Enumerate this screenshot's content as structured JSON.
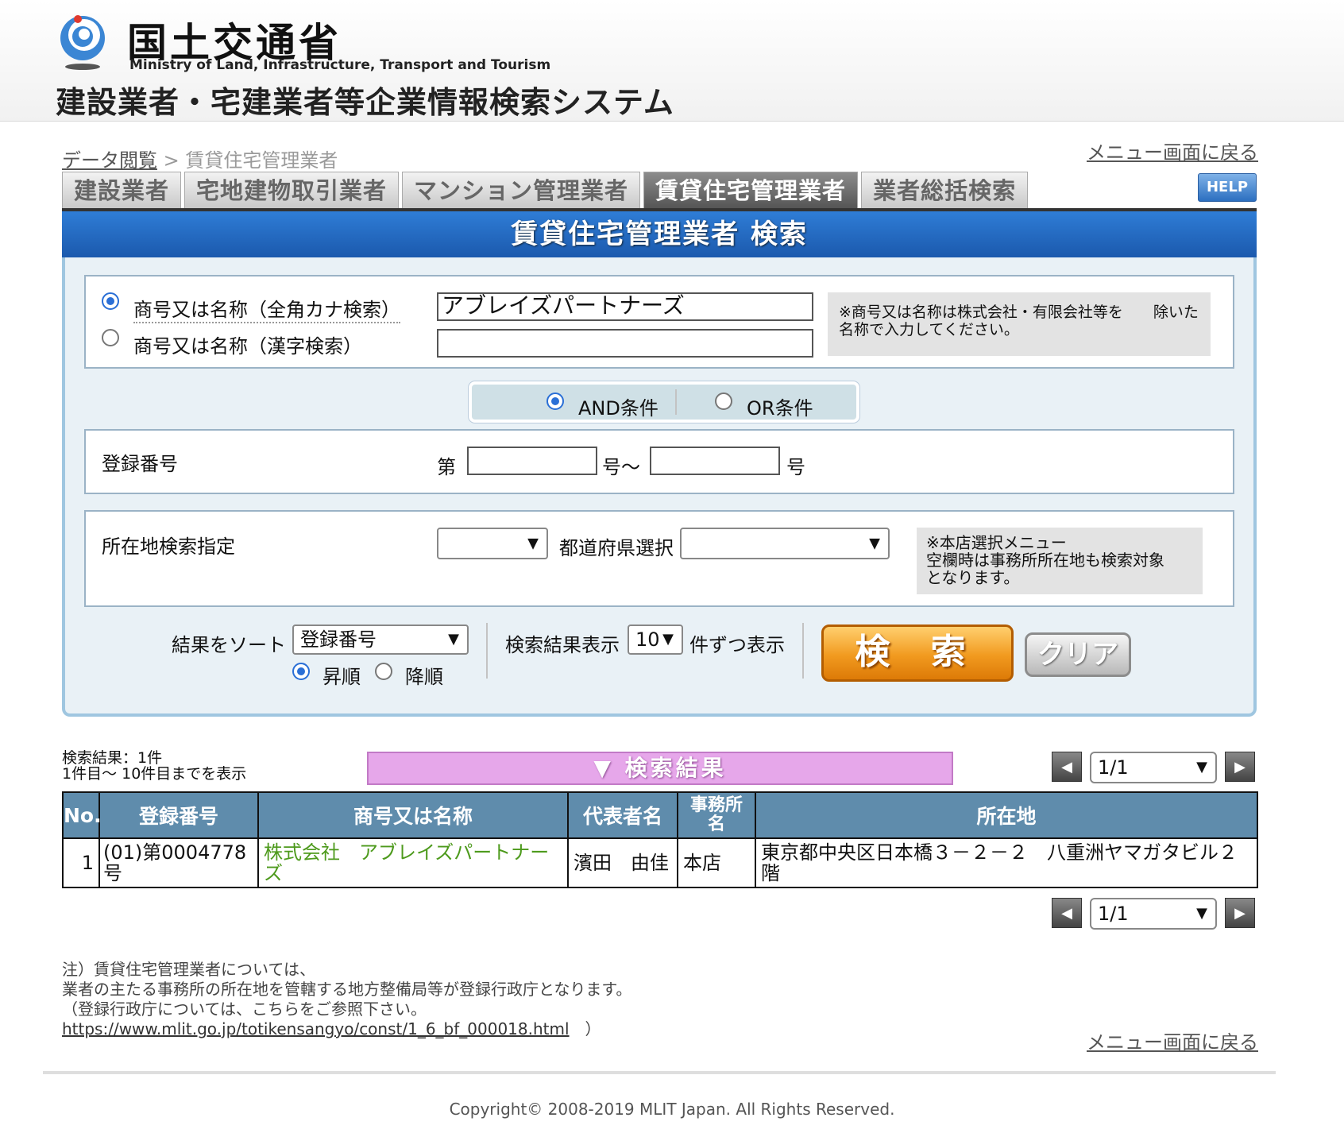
{
  "header": {
    "ministry_jp": "国土交通省",
    "ministry_en": "Ministry of Land, Infrastructure, Transport and Tourism",
    "system_title": "建設業者・宅建業者等企業情報検索システム"
  },
  "breadcrumb": {
    "root": "データ閲覧",
    "separator": " > ",
    "current": "賃貸住宅管理業者"
  },
  "back_to_menu": "メニュー画面に戻る",
  "tabs": [
    {
      "label": "建設業者"
    },
    {
      "label": "宅地建物取引業者"
    },
    {
      "label": "マンション管理業者"
    },
    {
      "label": "賃貸住宅管理業者",
      "active": true
    },
    {
      "label": "業者総括検索"
    }
  ],
  "help_label": "HELP",
  "panel_title": "賃貸住宅管理業者 検索",
  "name_search": {
    "option_kana": "商号又は名称（全角カナ検索）",
    "option_kanji": "商号又は名称（漢字検索）",
    "kana_value": "アブレイズパートナーズ",
    "kanji_value": "",
    "note": "※商号又は名称は株式会社・有限会社等を　　除いた名称で入力してください。"
  },
  "condition": {
    "and_label": "AND条件",
    "or_label": "OR条件",
    "selected": "AND"
  },
  "registration": {
    "label": "登録番号",
    "prefix": "第",
    "mid": "号〜",
    "suffix": "号",
    "from_value": "",
    "to_value": ""
  },
  "location": {
    "label": "所在地検索指定",
    "location_value": "",
    "pref_label": "都道府県選択",
    "pref_value": "",
    "note_line1": "※本店選択メニュー",
    "note_line2": "空欄時は事務所所在地も検索対象",
    "note_line3": "となります。"
  },
  "sort": {
    "label": "結果をソート",
    "value": "登録番号",
    "asc_label": "昇順",
    "desc_label": "降順",
    "selected": "asc"
  },
  "display": {
    "label": "検索結果表示",
    "value": "10",
    "suffix": "件ずつ表示"
  },
  "buttons": {
    "search": "検 索",
    "clear": "クリア"
  },
  "results": {
    "count_line1": "検索結果：1件",
    "count_line2": "1件目〜 10件目までを表示",
    "banner": "▼ 検索結果",
    "page_value": "1/1",
    "columns": [
      "No.",
      "登録番号",
      "商号又は名称",
      "代表者名",
      "事務所名",
      "所在地"
    ],
    "rows": [
      {
        "no": "1",
        "reg": "(01)第0004778号",
        "name": "株式会社　アブレイズパートナーズ",
        "rep": "濱田　由佳",
        "office": "本店",
        "address": "東京都中央区日本橋３－２－２　八重洲ヤマガタビル２階"
      }
    ]
  },
  "footnote": {
    "line1": "注）賃貸住宅管理業者については、",
    "line2": "業者の主たる事務所の所在地を管轄する地方整備局等が登録行政庁となります。",
    "line3": "（登録行政庁については、こちらをご参照下さい。",
    "link": "https://www.mlit.go.jp/totikensangyo/const/1_6_bf_000018.html",
    "close": "　）"
  },
  "copyright": "Copyright© 2008-2019 MLIT Japan. All Rights Reserved.",
  "colors": {
    "panel_blue": "#1b59ad",
    "result_header": "#5f8cac",
    "banner_pink": "#e6a7ea",
    "search_orange": "#f19a1f",
    "link_green": "#4d9a1c"
  }
}
